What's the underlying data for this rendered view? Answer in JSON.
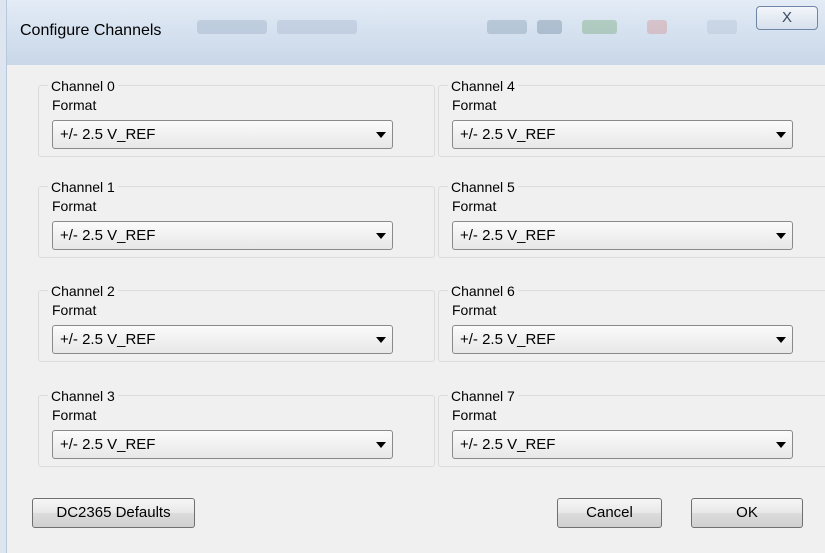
{
  "window": {
    "title": "Configure Channels",
    "close_glyph": "X"
  },
  "channels": [
    {
      "name": "Channel 0",
      "format_label": "Format",
      "value": "+/- 2.5 V_REF"
    },
    {
      "name": "Channel 1",
      "format_label": "Format",
      "value": "+/- 2.5 V_REF"
    },
    {
      "name": "Channel 2",
      "format_label": "Format",
      "value": "+/- 2.5 V_REF"
    },
    {
      "name": "Channel 3",
      "format_label": "Format",
      "value": "+/- 2.5 V_REF"
    },
    {
      "name": "Channel 4",
      "format_label": "Format",
      "value": "+/- 2.5 V_REF"
    },
    {
      "name": "Channel 5",
      "format_label": "Format",
      "value": "+/- 2.5 V_REF"
    },
    {
      "name": "Channel 6",
      "format_label": "Format",
      "value": "+/- 2.5 V_REF"
    },
    {
      "name": "Channel 7",
      "format_label": "Format",
      "value": "+/- 2.5 V_REF"
    }
  ],
  "buttons": {
    "defaults": "DC2365 Defaults",
    "cancel": "Cancel",
    "ok": "OK"
  }
}
